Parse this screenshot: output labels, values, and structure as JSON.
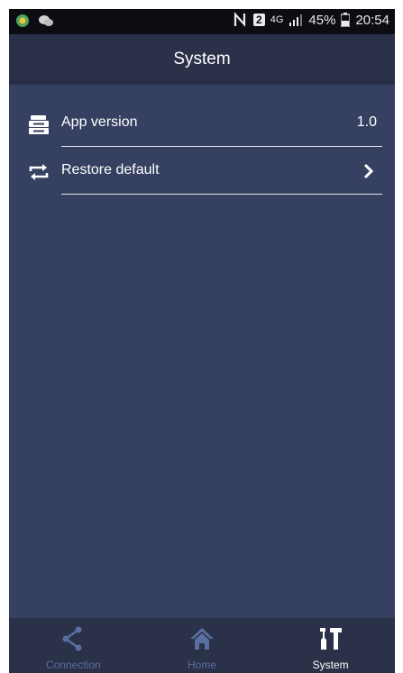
{
  "status_bar": {
    "network": "4G",
    "sim": "2",
    "battery": "45%",
    "time": "20:54"
  },
  "header": {
    "title": "System"
  },
  "settings": [
    {
      "label": "App version",
      "value": "1.0",
      "icon": "archive-box-icon"
    },
    {
      "label": "Restore default",
      "icon": "restore-arrows-icon",
      "action": "chevron-right-icon"
    }
  ],
  "bottom_nav": {
    "tabs": [
      {
        "label": "Connection",
        "icon": "share-icon",
        "active": false
      },
      {
        "label": "Home",
        "icon": "home-icon",
        "active": false
      },
      {
        "label": "System",
        "icon": "tools-icon",
        "active": true
      }
    ]
  },
  "colors": {
    "background": "#364061",
    "header": "#2a3148",
    "inactive_tab": "#5b6ea1",
    "active_tab": "#ffffff"
  }
}
